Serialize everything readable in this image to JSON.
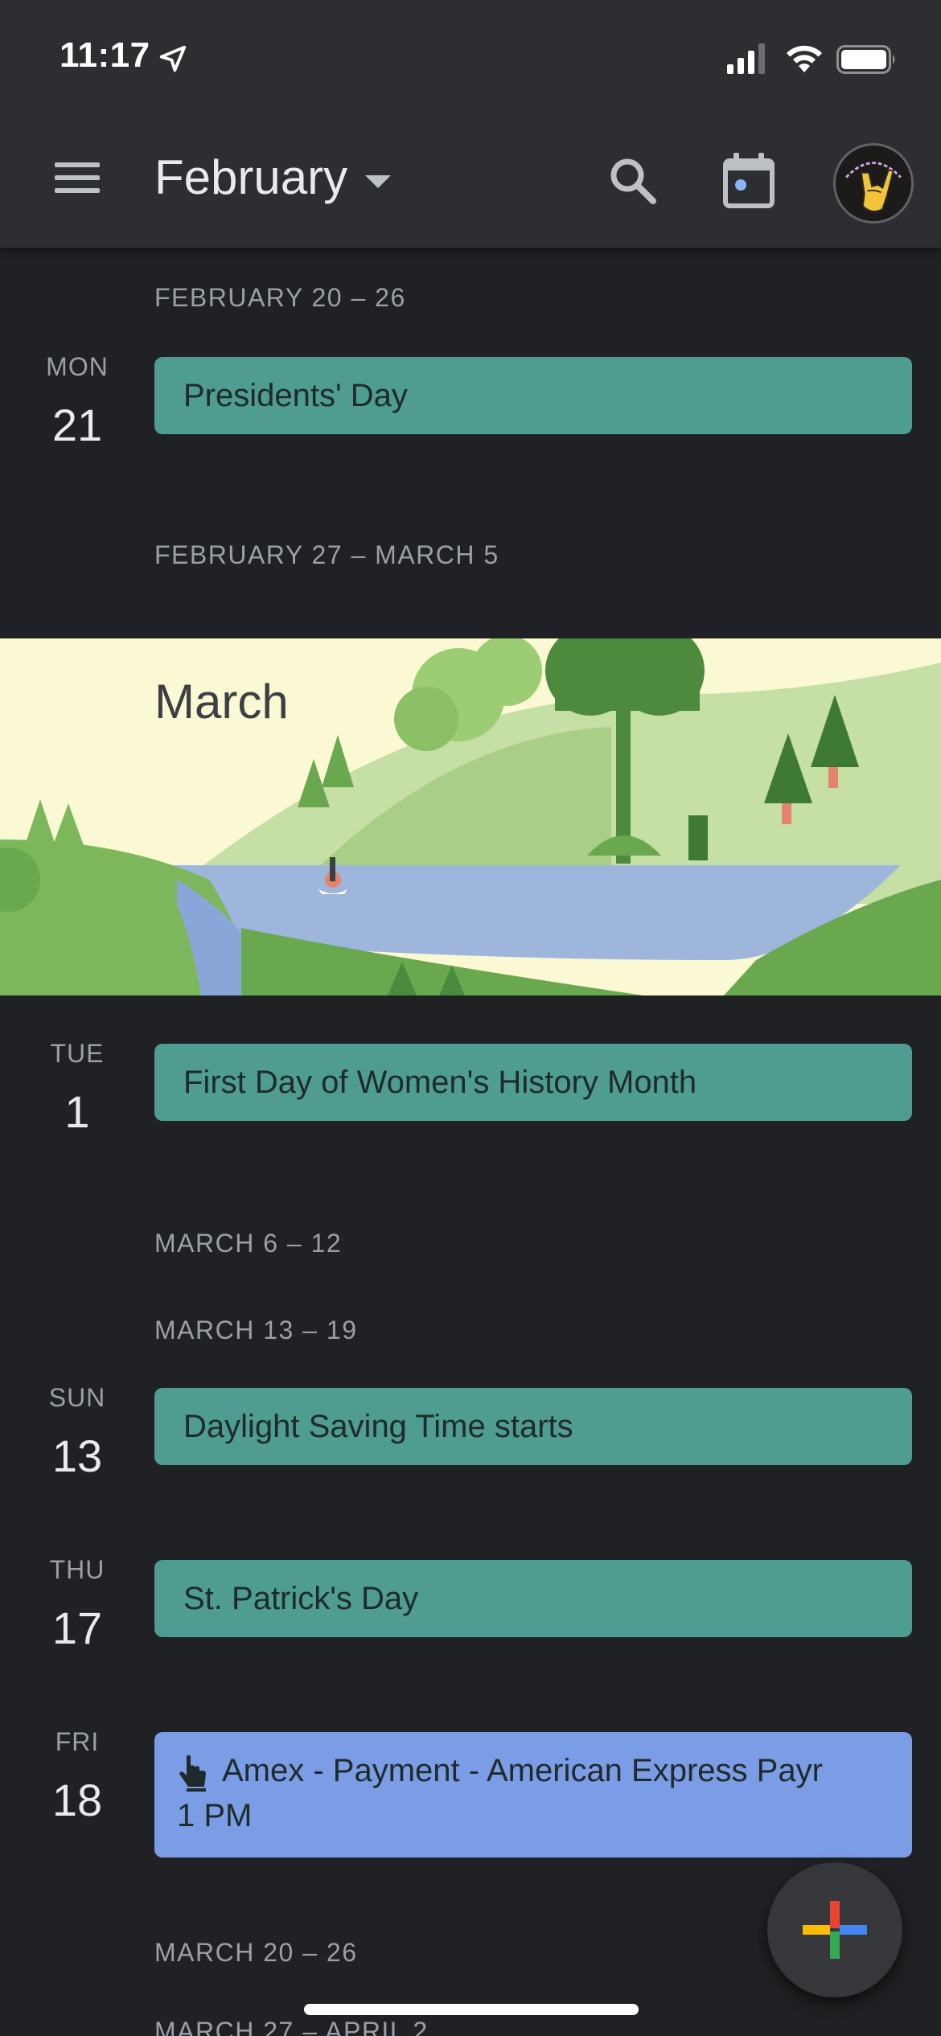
{
  "status_bar": {
    "time": "11:17",
    "icons": [
      "location-arrow-icon",
      "cellular-signal-icon",
      "wifi-icon",
      "battery-icon"
    ]
  },
  "app_bar": {
    "month": "February",
    "icons": [
      "menu-icon",
      "dropdown-caret-icon",
      "search-icon",
      "today-calendar-icon",
      "profile-avatar"
    ]
  },
  "agenda": {
    "week1": "FEBRUARY 20 – 26",
    "day_mon21": {
      "dow": "MON",
      "num": "21",
      "event": "Presidents' Day"
    },
    "week2": "FEBRUARY 27 – MARCH 5",
    "month_banner": "March",
    "day_tue1": {
      "dow": "TUE",
      "num": "1",
      "event": "First Day of Women's History Month"
    },
    "week3": "MARCH 6 – 12",
    "week4": "MARCH 13 – 19",
    "day_sun13": {
      "dow": "SUN",
      "num": "13",
      "event": "Daylight Saving Time starts"
    },
    "day_thu17": {
      "dow": "THU",
      "num": "17",
      "event": "St. Patrick's Day"
    },
    "day_fri18": {
      "dow": "FRI",
      "num": "18",
      "event": "Amex - Payment - American Express Payr",
      "time": "1 PM",
      "icon": "tap-gesture-icon"
    },
    "week5": "MARCH 20 – 26",
    "week6": "MARCH 27 – APRIL 2"
  },
  "fab": {
    "icon": "plus-icon"
  },
  "colors": {
    "background": "#202124",
    "app_bar": "#2d2e31",
    "holiday_event": "#4e9d90",
    "reminder_event": "#7b9de5",
    "text_primary": "#e8eaed",
    "text_secondary": "#9aa0a6"
  }
}
